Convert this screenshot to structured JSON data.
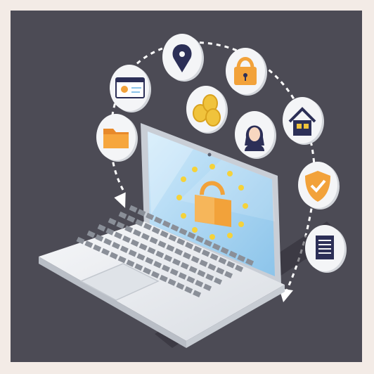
{
  "scene": {
    "subject": "laptop-with-gdpr-security-icons",
    "colors": {
      "page_background": "#f3ebe6",
      "panel_background": "#4c4b55",
      "laptop_body": "#e9ebee",
      "laptop_bezel": "#c9ced6",
      "screen_light": "#bfe1f7",
      "screen_dark": "#8cc4ea",
      "eu_star": "#f5d23a",
      "lock_orange": "#f2a23a",
      "icon_bubble": "#f4f5f7",
      "icon_navy": "#2c2f57",
      "dashed_arrow": "#ffffff"
    },
    "icons": [
      {
        "name": "location-pin-icon"
      },
      {
        "name": "padlock-icon"
      },
      {
        "name": "id-card-icon"
      },
      {
        "name": "coins-icon"
      },
      {
        "name": "user-avatar-icon"
      },
      {
        "name": "home-icon"
      },
      {
        "name": "folder-icon"
      },
      {
        "name": "shield-check-icon"
      },
      {
        "name": "document-icon"
      }
    ]
  }
}
